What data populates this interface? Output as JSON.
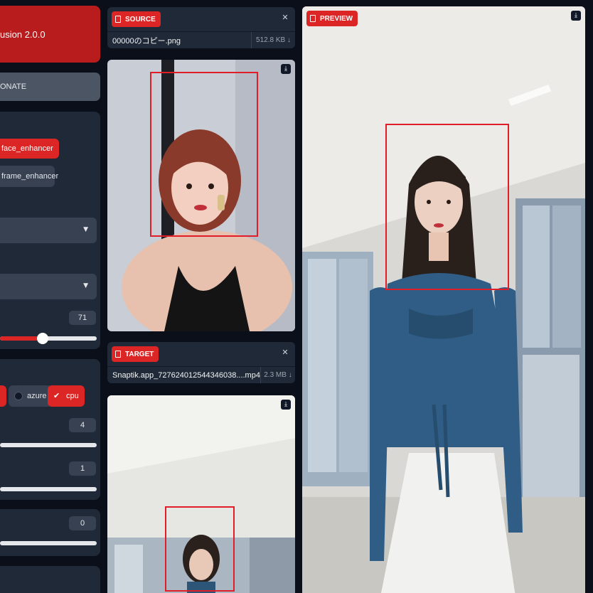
{
  "app": {
    "title": "usion 2.0.0",
    "donate_label": "ONATE"
  },
  "processors": {
    "items": [
      {
        "label": "face_enhancer",
        "selected": true
      },
      {
        "label": "frame_enhancer",
        "selected": false
      }
    ]
  },
  "slider_main": {
    "value": "71",
    "level_percent": 44
  },
  "execution_providers": {
    "items": [
      {
        "label": "azure",
        "selected": false
      },
      {
        "label": "cpu",
        "selected": true
      }
    ]
  },
  "thread_count": {
    "value": "4"
  },
  "queue_count": {
    "value": "1"
  },
  "extra_value": {
    "value": "0"
  },
  "source": {
    "badge": "SOURCE",
    "file_name": "00000のコピー.png",
    "file_size": "512.8 KB ↓"
  },
  "target": {
    "badge": "TARGET",
    "file_name": "Snaptik.app_727624012544346038....mp4",
    "file_size": "2.3 MB ↓"
  },
  "preview": {
    "badge": "PREVIEW"
  },
  "colors": {
    "accent": "#dc2626",
    "panel": "#1f2937",
    "background": "#0b0f19"
  }
}
